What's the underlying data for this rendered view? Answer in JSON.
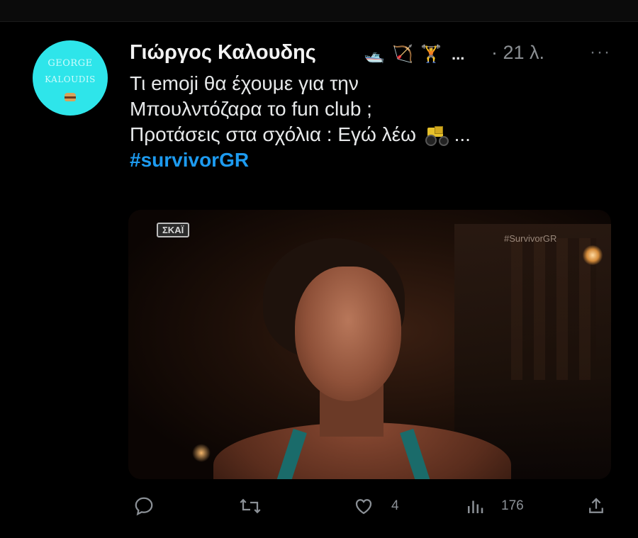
{
  "profile": {
    "avatar_line1": "GEORGE",
    "avatar_line2": "KALOUDIS"
  },
  "header": {
    "display_name": "Γιώργος Καλουδης",
    "name_emojis": [
      "🛥️",
      "🏹",
      "🏋️"
    ],
    "ellipsis": "...",
    "time": "· 21 λ."
  },
  "tweet": {
    "line1": "Τι emoji θα έχουμε για την",
    "line2": "Μπουλντόζαρα το fun club ;",
    "line3_text": "Προτάσεις  στα σχόλια : Εγώ λέω",
    "line3_tail": "...",
    "hashtag": "#survivorGR"
  },
  "media": {
    "channel_logo": "ΣΚΑΪ",
    "watermark": "#SurvivorGR"
  },
  "actions": {
    "reply_count": "",
    "retweet_count": "",
    "like_count": "4",
    "views_count": "176"
  },
  "icons": {
    "reply": "reply-icon",
    "retweet": "retweet-icon",
    "like": "heart-icon",
    "views": "views-icon",
    "share": "share-icon",
    "more": "more-icon"
  },
  "colors": {
    "background": "#000000",
    "hashtag": "#1d9bf0",
    "muted": "#8b9096",
    "avatar": "#2ee5ea"
  }
}
